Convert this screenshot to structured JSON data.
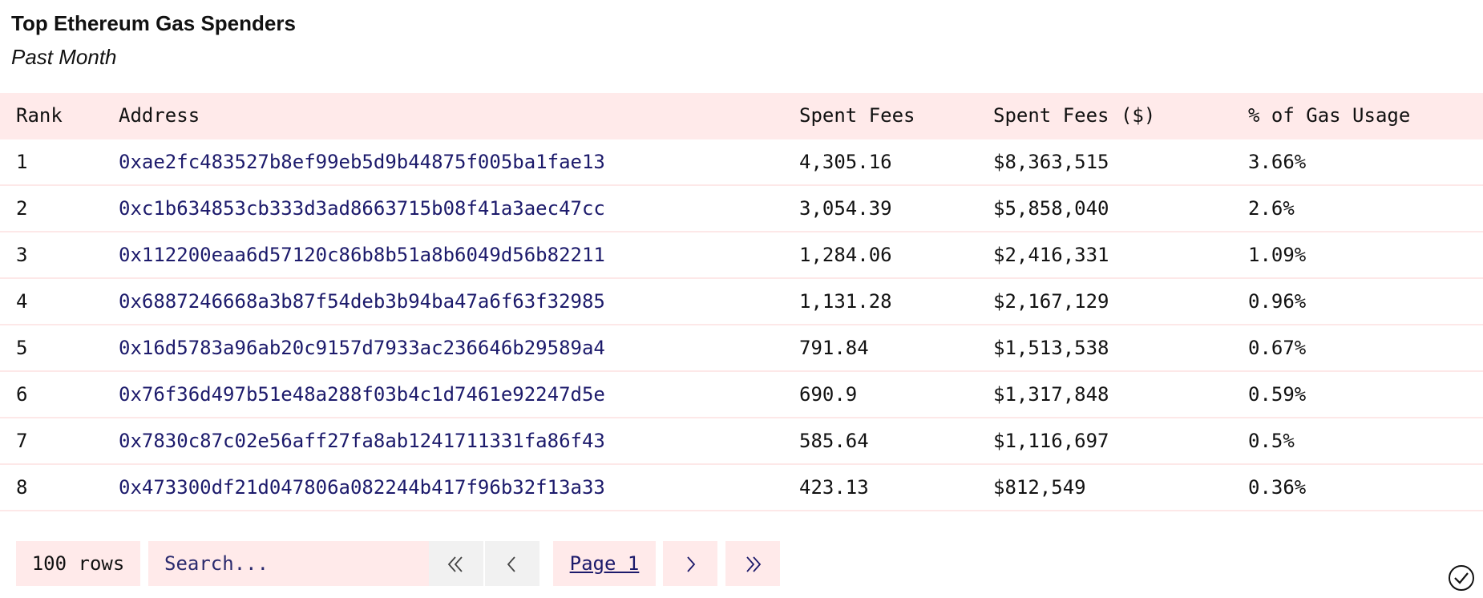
{
  "header": {
    "title": "Top Ethereum Gas Spenders",
    "subtitle": "Past Month"
  },
  "table": {
    "columns": [
      "Rank",
      "Address",
      "Spent Fees",
      "Spent Fees ($)",
      "% of Gas Usage"
    ],
    "rows": [
      {
        "rank": "1",
        "address": "0xae2fc483527b8ef99eb5d9b44875f005ba1fae13",
        "fees": "4,305.16",
        "usd": "$8,363,515",
        "pct": "3.66%"
      },
      {
        "rank": "2",
        "address": "0xc1b634853cb333d3ad8663715b08f41a3aec47cc",
        "fees": "3,054.39",
        "usd": "$5,858,040",
        "pct": "2.6%"
      },
      {
        "rank": "3",
        "address": "0x112200eaa6d57120c86b8b51a8b6049d56b82211",
        "fees": "1,284.06",
        "usd": "$2,416,331",
        "pct": "1.09%"
      },
      {
        "rank": "4",
        "address": "0x6887246668a3b87f54deb3b94ba47a6f63f32985",
        "fees": "1,131.28",
        "usd": "$2,167,129",
        "pct": "0.96%"
      },
      {
        "rank": "5",
        "address": "0x16d5783a96ab20c9157d7933ac236646b29589a4",
        "fees": "791.84",
        "usd": "$1,513,538",
        "pct": "0.67%"
      },
      {
        "rank": "6",
        "address": "0x76f36d497b51e48a288f03b4c1d7461e92247d5e",
        "fees": "690.9",
        "usd": "$1,317,848",
        "pct": "0.59%"
      },
      {
        "rank": "7",
        "address": "0x7830c87c02e56aff27fa8ab1241711331fa86f43",
        "fees": "585.64",
        "usd": "$1,116,697",
        "pct": "0.5%"
      },
      {
        "rank": "8",
        "address": "0x473300df21d047806a082244b417f96b32f13a33",
        "fees": "423.13",
        "usd": "$812,549",
        "pct": "0.36%"
      }
    ]
  },
  "controls": {
    "rows_label": "100 rows",
    "search_placeholder": "Search...",
    "search_value": "",
    "page_label": "Page 1",
    "icons": {
      "first": "double-chevron-left-icon",
      "prev": "chevron-left-icon",
      "next": "chevron-right-icon",
      "last": "double-chevron-right-icon",
      "status": "check-circle-icon"
    }
  },
  "colors": {
    "header_bg": "#ffeaea",
    "address_text": "#1c1a6b",
    "disabled_bg": "#f1f1f1"
  }
}
